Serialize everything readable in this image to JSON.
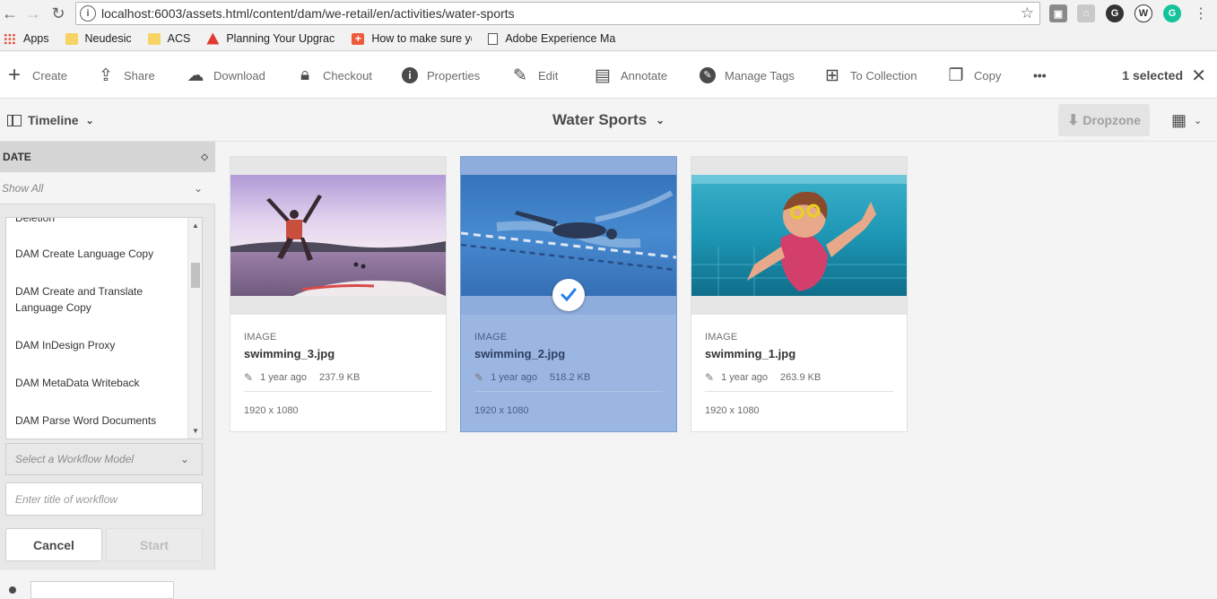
{
  "browser": {
    "url": "localhost:6003/assets.html/content/dam/we-retail/en/activities/water-sports"
  },
  "bookmarks": [
    {
      "label": "Apps",
      "icon": "apps-grid-icon"
    },
    {
      "label": "Neudesic",
      "icon": "folder-icon"
    },
    {
      "label": "ACS",
      "icon": "folder-icon"
    },
    {
      "label": "Planning Your Upgrac",
      "icon": "adobe-icon"
    },
    {
      "label": "How to make sure yo",
      "icon": "plus-icon"
    },
    {
      "label": "Adobe Experience Ma",
      "icon": "page-icon"
    }
  ],
  "actions": {
    "create": "Create",
    "share": "Share",
    "download": "Download",
    "checkout": "Checkout",
    "properties": "Properties",
    "edit": "Edit",
    "annotate": "Annotate",
    "manage_tags": "Manage Tags",
    "to_collection": "To Collection",
    "copy": "Copy",
    "more": "•••",
    "selected": "1 selected"
  },
  "header": {
    "rail_label": "Timeline",
    "title": "Water Sports",
    "dropzone": "Dropzone"
  },
  "rail": {
    "section": "DATE",
    "filter": "Show All",
    "workflows": [
      "Deletion",
      "DAM Create Language Copy",
      "DAM Create and Translate Language Copy",
      "DAM InDesign Proxy",
      "DAM MetaData Writeback",
      "DAM Parse Word Documents"
    ],
    "select_placeholder": "Select a Workflow Model",
    "title_placeholder": "Enter title of workflow",
    "cancel": "Cancel",
    "start": "Start"
  },
  "cards": [
    {
      "type": "IMAGE",
      "name": "swimming_3.jpg",
      "modified": "1 year ago",
      "size": "237.9 KB",
      "dims": "1920 x 1080",
      "selected": false
    },
    {
      "type": "IMAGE",
      "name": "swimming_2.jpg",
      "modified": "1 year ago",
      "size": "518.2 KB",
      "dims": "1920 x 1080",
      "selected": true
    },
    {
      "type": "IMAGE",
      "name": "swimming_1.jpg",
      "modified": "1 year ago",
      "size": "263.9 KB",
      "dims": "1920 x 1080",
      "selected": false
    }
  ],
  "colors": {
    "selected_card": "#9bb6e0",
    "accent": "#2680eb"
  }
}
